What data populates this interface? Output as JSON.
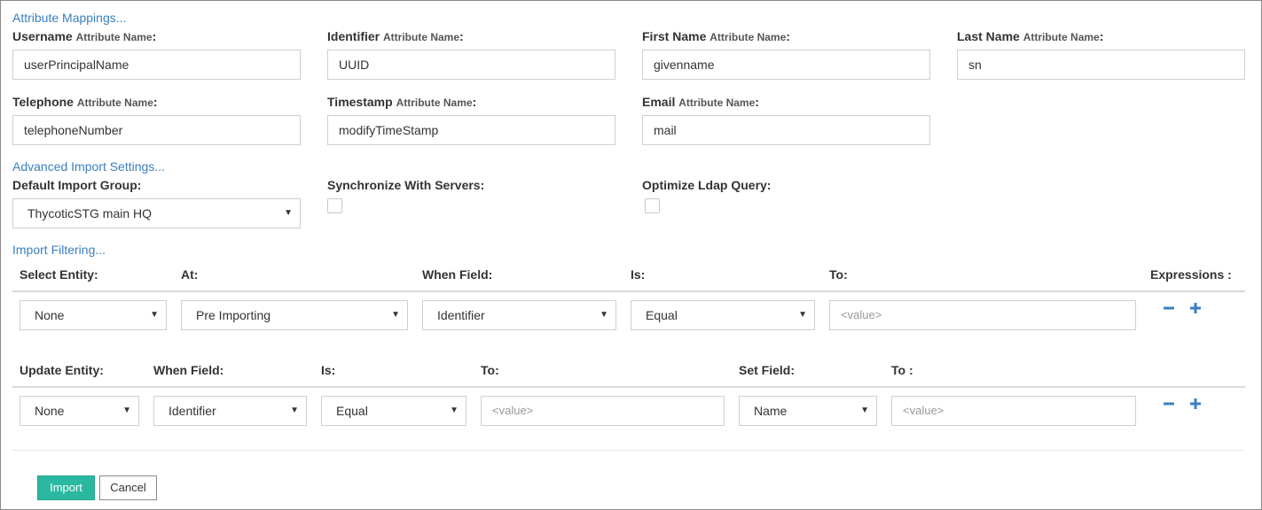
{
  "sections": {
    "attribute_mappings": "Attribute Mappings...",
    "advanced_import": "Advanced Import Settings...",
    "import_filtering": "Import Filtering..."
  },
  "attr_suffix": "Attribute Name",
  "colon": ":",
  "mappings": [
    {
      "label": "Username",
      "value": "userPrincipalName"
    },
    {
      "label": "Identifier",
      "value": "UUID"
    },
    {
      "label": "First Name",
      "value": "givenname"
    },
    {
      "label": "Last Name",
      "value": "sn"
    },
    {
      "label": "Telephone",
      "value": "telephoneNumber"
    },
    {
      "label": "Timestamp",
      "value": "modifyTimeStamp"
    },
    {
      "label": "Email",
      "value": "mail"
    }
  ],
  "advanced": {
    "default_group_label": "Default Import Group:",
    "default_group_value": "ThycoticSTG main HQ",
    "sync_label": "Synchronize With Servers:",
    "optimize_label": "Optimize Ldap Query:"
  },
  "filter": {
    "headers": {
      "select_entity": "Select Entity:",
      "at": "At:",
      "when_field": "When Field:",
      "is": "Is:",
      "to": "To:",
      "expressions": "Expressions :"
    },
    "row": {
      "entity": "None",
      "at": "Pre Importing",
      "field": "Identifier",
      "is": "Equal",
      "to_placeholder": "<value>"
    }
  },
  "update": {
    "headers": {
      "update_entity": "Update Entity:",
      "when_field": "When Field:",
      "is": "Is:",
      "to": "To:",
      "set_field": "Set Field:",
      "to2": "To :"
    },
    "row": {
      "entity": "None",
      "field": "Identifier",
      "is": "Equal",
      "to_placeholder": "<value>",
      "set_field": "Name",
      "to2_placeholder": "<value>"
    }
  },
  "buttons": {
    "import": "Import",
    "cancel": "Cancel"
  },
  "icons": {
    "caret": "▼",
    "minus": "minus-icon",
    "plus": "plus-icon"
  },
  "colors": {
    "link": "#3a7fc1",
    "primary": "#2ab8a0",
    "icon": "#3a7fc1"
  }
}
